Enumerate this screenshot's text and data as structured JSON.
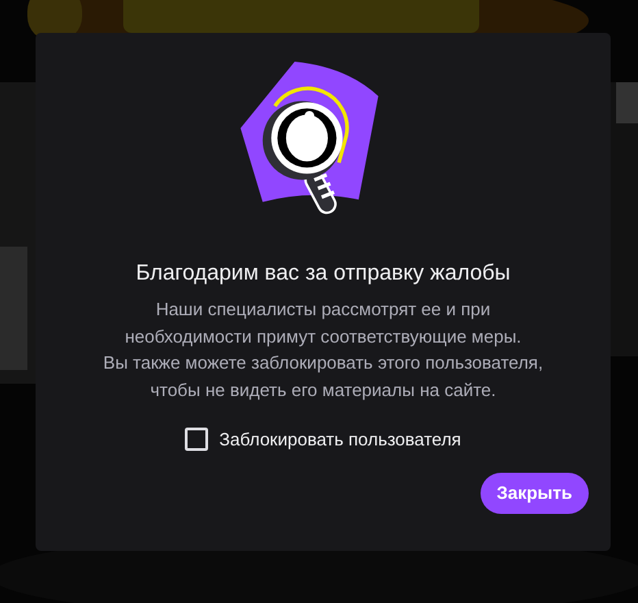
{
  "dialog": {
    "title": "Благодарим вас за отправку жалобы",
    "message": "Наши специалисты рассмотрят ее и при\nнеобходимости примут соответствующие меры.\nВы также можете заблокировать этого пользователя,\nчтобы не видеть его материалы на сайте.",
    "block_option": {
      "label": "Заблокировать пользователя",
      "checked": false
    },
    "close_button": "Закрыть"
  }
}
